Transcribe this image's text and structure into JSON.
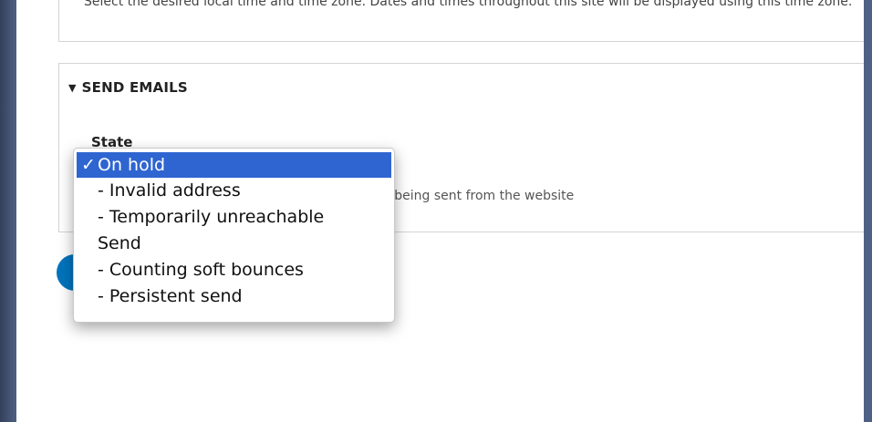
{
  "timezone": {
    "description": "Select the desired local time and time zone. Dates and times throughout this site will be displayed using this time zone."
  },
  "send_emails": {
    "title": "SEND EMAILS",
    "state_label": "State",
    "description": "Choose whether email should be stopped form being sent from the website"
  },
  "actions": {
    "save_label": ""
  },
  "dropdown": {
    "check_glyph": "✓",
    "options": [
      {
        "label": "On hold",
        "selected": true
      },
      {
        "label": "- Invalid address",
        "selected": false
      },
      {
        "label": "- Temporarily unreachable",
        "selected": false
      },
      {
        "label": "Send",
        "selected": false
      },
      {
        "label": "- Counting soft bounces",
        "selected": false
      },
      {
        "label": "- Persistent send",
        "selected": false
      }
    ]
  },
  "colors": {
    "selected_bg": "#2f65d1",
    "button_bg": "#0074bd",
    "desktop_bg": "#4e6084"
  }
}
